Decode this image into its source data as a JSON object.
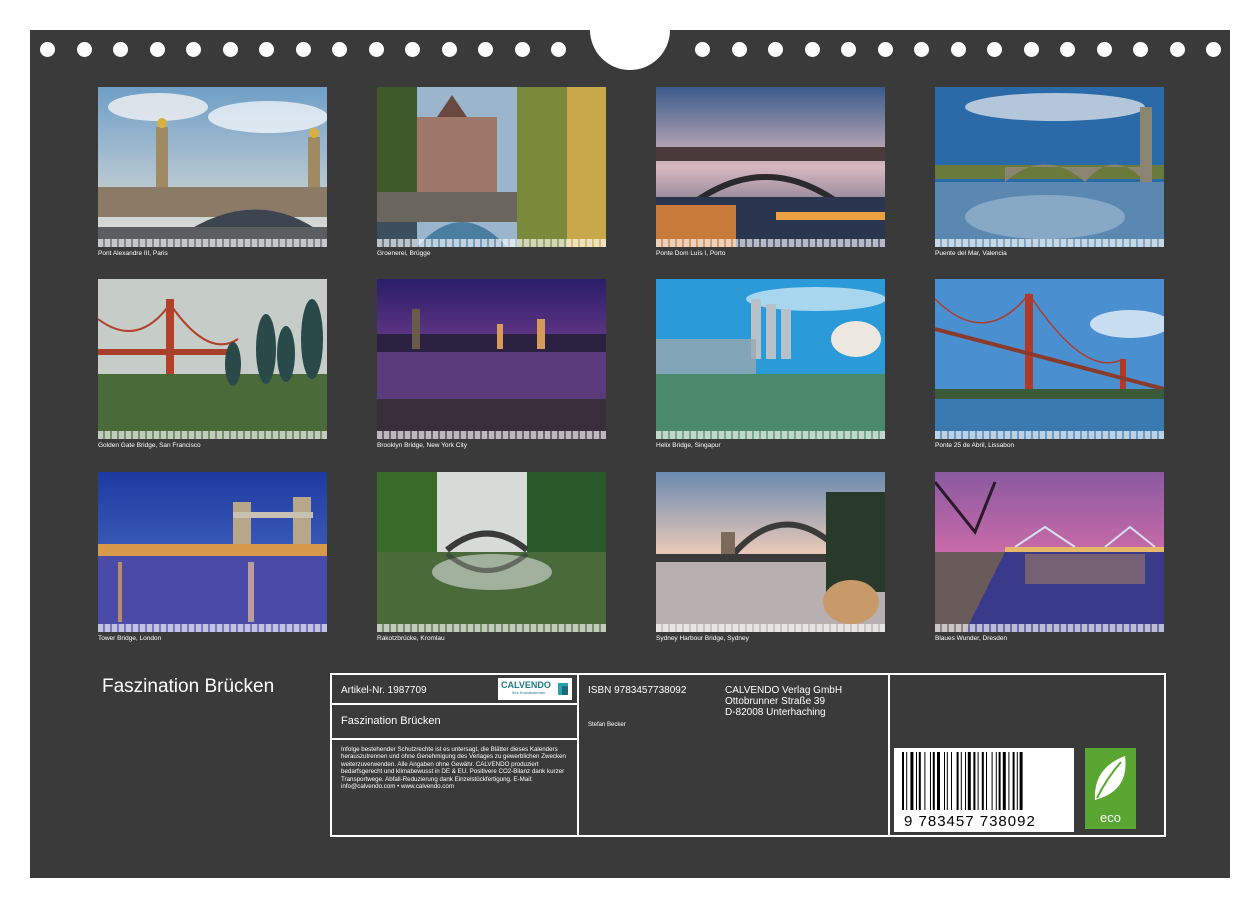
{
  "calendar_title": "Faszination Brücken",
  "photos": [
    {
      "caption": "Pont Alexandre III, Paris"
    },
    {
      "caption": "Groenerei, Brügge"
    },
    {
      "caption": "Ponte Dom Luís I, Porto"
    },
    {
      "caption": "Puente del Mar, Valencia"
    },
    {
      "caption": "Golden Gate Bridge, San Francisco"
    },
    {
      "caption": "Brooklyn Bridge, New York City"
    },
    {
      "caption": "Helix Bridge, Singapur"
    },
    {
      "caption": "Ponte 25 de Abril, Lissabon"
    },
    {
      "caption": "Tower Bridge, London"
    },
    {
      "caption": "Rakotzbrücke, Kromlau"
    },
    {
      "caption": "Sydney Harbour Bridge, Sydney"
    },
    {
      "caption": "Blaues Wunder, Dresden"
    }
  ],
  "info": {
    "article": "Artikel-Nr. 1987709",
    "logo_name": "CALVENDO",
    "logo_sub": "Ihre Kunstkalender",
    "title": "Faszination Brücken",
    "legal": "Infolge bestehender Schutzrechte ist es untersagt, die Blätter dieses Kalenders herauszutrennen und ohne Genehmigung des Verlages zu gewerblichen Zwecken weiterzuverwenden. Alle Angaben ohne Gewähr. CALVENDO produziert bedarfsgerecht und klimabewusst in DE & EU. Positivere CO2-Bilanz dank kurzer Transportwege. Abfall-Reduzierung dank Einzelstückfertigung. E-Mail: info@calvendo.com • www.calvendo.com",
    "isbn": "ISBN 9783457738092",
    "author": "Stefan Becker",
    "publisher_line1": "CALVENDO Verlag GmbH",
    "publisher_line2": "Ottobrunner Straße 39",
    "publisher_line3": "D-82008 Unterhaching",
    "barcode_digits": "9 783457 738092",
    "eco_label": "eco"
  },
  "colors": {
    "background": "#3a3a3a",
    "eco_green": "#5aa632",
    "logo_teal": "#1e7a8a"
  }
}
